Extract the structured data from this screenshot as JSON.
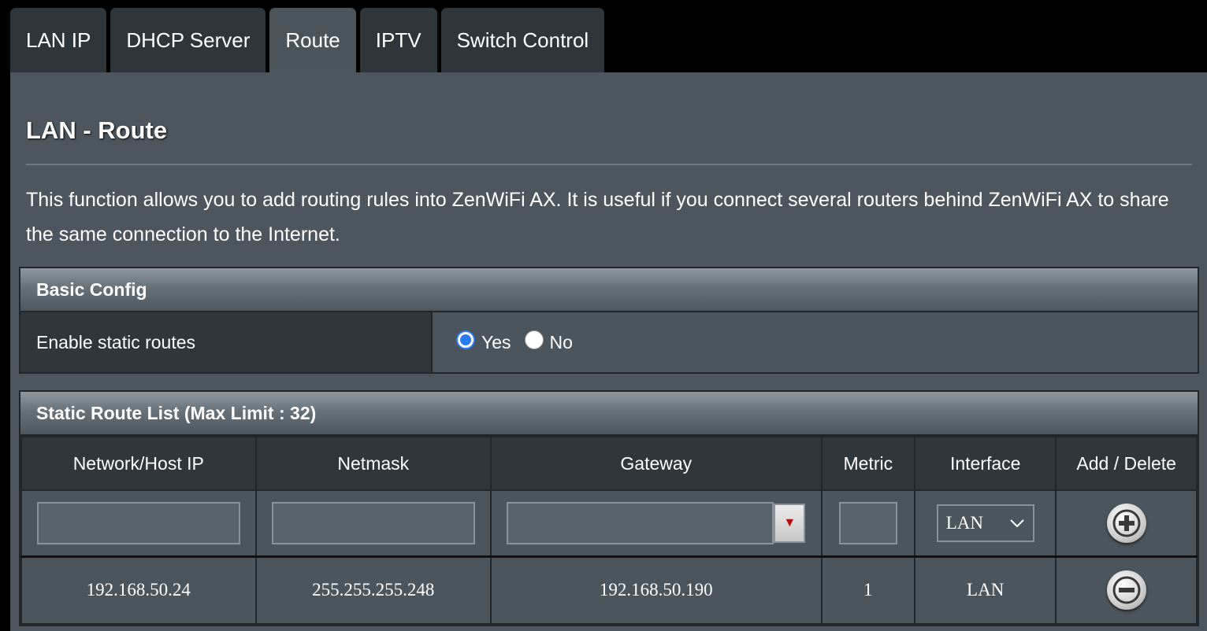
{
  "tabs": [
    {
      "label": "LAN IP",
      "active": false
    },
    {
      "label": "DHCP Server",
      "active": false
    },
    {
      "label": "Route",
      "active": true
    },
    {
      "label": "IPTV",
      "active": false
    },
    {
      "label": "Switch Control",
      "active": false
    }
  ],
  "page": {
    "title": "LAN - Route",
    "description": "This function allows you to add routing rules into ZenWiFi AX. It is useful if you connect several routers behind ZenWiFi AX to share the same connection to the Internet."
  },
  "basic_config": {
    "header": "Basic Config",
    "enable_label": "Enable static routes",
    "yes_label": "Yes",
    "no_label": "No",
    "selected": "Yes"
  },
  "route_list": {
    "header": "Static Route List (Max Limit : 32)",
    "columns": [
      "Network/Host IP",
      "Netmask",
      "Gateway",
      "Metric",
      "Interface",
      "Add / Delete"
    ],
    "new_row": {
      "network": "",
      "netmask": "",
      "gateway": "",
      "metric": "",
      "interface": "LAN"
    },
    "rows": [
      {
        "network": "192.168.50.24",
        "netmask": "255.255.255.248",
        "gateway": "192.168.50.190",
        "metric": "1",
        "interface": "LAN"
      }
    ]
  },
  "colors": {
    "accent": "#2b7bf3",
    "panel": "#4d565e",
    "dark_cell": "#2f373c"
  }
}
